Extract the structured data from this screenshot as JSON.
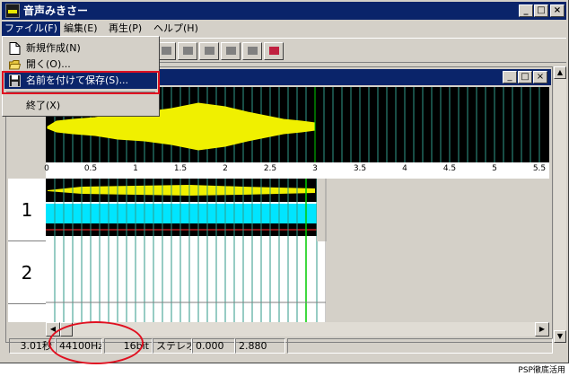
{
  "app": {
    "title": "音声みきさー",
    "colors": {
      "titlebar": "#0a246a",
      "face": "#d4d0c8",
      "waveform": "#f0f000",
      "track_fill": "#00e5ff",
      "grid": "#33aa99",
      "playhead": "#00cc00",
      "annotation": "#e01020"
    }
  },
  "window_controls": {
    "minimize": "_",
    "maximize": "□",
    "close": "×"
  },
  "menubar": {
    "items": [
      {
        "label": "ファイル(F)"
      },
      {
        "label": "編集(E)"
      },
      {
        "label": "再生(P)"
      },
      {
        "label": "ヘルプ(H)"
      }
    ]
  },
  "file_menu": {
    "items": [
      {
        "label": "新規作成(N)",
        "icon": "new-file-icon"
      },
      {
        "label": "開く(O)...",
        "icon": "open-folder-icon"
      },
      {
        "label": "名前を付けて保存(S)...",
        "icon": "floppy-disk-icon",
        "highlighted": true
      },
      {
        "label": "終了(X)",
        "icon": ""
      }
    ]
  },
  "toolbar": {
    "buttons": [
      "record-icon",
      "stop-icon",
      "play-icon",
      "loop-icon",
      "mute-icon",
      "mix-icon"
    ]
  },
  "ruler": {
    "ticks": [
      "0",
      "0.5",
      "1",
      "1.5",
      "2",
      "2.5",
      "3",
      "3.5",
      "4",
      "4.5",
      "5",
      "5.5"
    ]
  },
  "tracks": [
    {
      "number": "1"
    },
    {
      "number": "2"
    }
  ],
  "statusbar": {
    "duration": "3.01秒",
    "sample_rate": "44100Hz",
    "bit_depth": "16bit",
    "channels": "ステレオ",
    "start": "0.000",
    "end": "2.880"
  },
  "watermark": "PSP徹底活用"
}
